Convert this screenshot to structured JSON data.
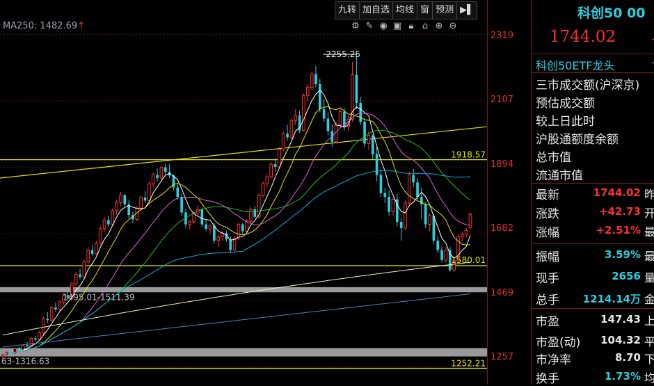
{
  "toolbar": [
    "九转",
    "加自选",
    "均线",
    "窗",
    "预测"
  ],
  "toolbar_pin": "▶▌",
  "ma_label": "MA250: 1482.69",
  "ma_arrow": "↑",
  "icons": [
    "gear-icon",
    "pen-icon",
    "eye-icon",
    "briefcase-icon",
    "lock-icon",
    "lock-open-icon",
    "zoom-in-icon",
    "zoom-out-icon"
  ],
  "y_ticks": [
    "2319",
    "2107",
    "1894",
    "1682",
    "1469",
    "1257"
  ],
  "annotations": {
    "high": "2255.25",
    "line1": "1918.57",
    "line2": "1580.01",
    "line3": "1252.21",
    "band1": "1495.01-1511.39",
    "band2": "63-1316.63"
  },
  "side": {
    "title": "科创50 00",
    "price": "1744.02",
    "price_tail": "+",
    "sector": "科创50ETF龙头",
    "sector_tail": "-",
    "info_labels": [
      "三市成交额(沪深京)",
      "预估成交额",
      "较上日此时",
      "沪股通额度余额",
      "总市值",
      "流通市值"
    ],
    "stats": [
      {
        "label": "最新",
        "value": "1744.02",
        "color": "#ff3030",
        "right": "昨"
      },
      {
        "label": "涨跌",
        "value": "+42.73",
        "color": "#ff3030",
        "right": "开"
      },
      {
        "label": "涨幅",
        "value": "+2.51%",
        "color": "#ff3030",
        "right": "最"
      },
      {
        "label": "振幅",
        "value": "3.59%",
        "color": "#2ad0e0",
        "right": "最"
      },
      {
        "label": "现手",
        "value": "2656",
        "color": "#2ad0e0",
        "right": "量"
      },
      {
        "label": "总手",
        "value": "1214.14万",
        "color": "#2ad0e0",
        "right": "金"
      },
      {
        "label": "市盈",
        "value": "147.43",
        "color": "#e8e8e8",
        "right": "上"
      },
      {
        "label": "市盈(动)",
        "value": "104.32",
        "color": "#e8e8e8",
        "right": "平"
      },
      {
        "label": "市净率",
        "value": "8.70",
        "color": "#e8e8e8",
        "right": "下"
      },
      {
        "label": "换手",
        "value": "1.73%",
        "color": "#2ad0e0",
        "right": "均"
      }
    ]
  },
  "colors": {
    "up": "#ff3030",
    "down": "#2ad0e0",
    "ma5": "#ffffff",
    "ma10": "#e6e600",
    "ma20": "#e060e0",
    "ma30": "#20c020",
    "ma60": "#00b0e0",
    "ma120": "#f0f0c0",
    "ma250": "#5080c0"
  },
  "chart_data": {
    "type": "candlestick",
    "ylim": [
      1200,
      2380
    ],
    "ohlc": [
      [
        1292,
        1300,
        1282,
        1296
      ],
      [
        1296,
        1310,
        1290,
        1304
      ],
      [
        1304,
        1312,
        1296,
        1300
      ],
      [
        1300,
        1318,
        1296,
        1314
      ],
      [
        1314,
        1320,
        1306,
        1310
      ],
      [
        1310,
        1330,
        1306,
        1326
      ],
      [
        1326,
        1336,
        1318,
        1322
      ],
      [
        1322,
        1352,
        1318,
        1348
      ],
      [
        1348,
        1356,
        1338,
        1344
      ],
      [
        1344,
        1372,
        1340,
        1366
      ],
      [
        1366,
        1418,
        1360,
        1410
      ],
      [
        1410,
        1432,
        1398,
        1406
      ],
      [
        1406,
        1450,
        1400,
        1446
      ],
      [
        1446,
        1462,
        1432,
        1440
      ],
      [
        1440,
        1470,
        1436,
        1464
      ],
      [
        1464,
        1492,
        1455,
        1486
      ],
      [
        1486,
        1500,
        1470,
        1478
      ],
      [
        1478,
        1530,
        1472,
        1522
      ],
      [
        1522,
        1560,
        1514,
        1552
      ],
      [
        1552,
        1570,
        1536,
        1544
      ],
      [
        1544,
        1600,
        1540,
        1592
      ],
      [
        1592,
        1640,
        1584,
        1630
      ],
      [
        1630,
        1646,
        1612,
        1618
      ],
      [
        1618,
        1660,
        1612,
        1652
      ],
      [
        1652,
        1706,
        1644,
        1698
      ],
      [
        1698,
        1736,
        1688,
        1726
      ],
      [
        1726,
        1740,
        1704,
        1712
      ],
      [
        1712,
        1764,
        1706,
        1756
      ],
      [
        1756,
        1790,
        1742,
        1782
      ],
      [
        1782,
        1816,
        1770,
        1806
      ],
      [
        1806,
        1808,
        1770,
        1776
      ],
      [
        1776,
        1790,
        1730,
        1742
      ],
      [
        1742,
        1752,
        1716,
        1728
      ],
      [
        1728,
        1770,
        1722,
        1764
      ],
      [
        1764,
        1804,
        1756,
        1798
      ],
      [
        1798,
        1818,
        1780,
        1788
      ],
      [
        1788,
        1850,
        1782,
        1842
      ],
      [
        1842,
        1878,
        1830,
        1870
      ],
      [
        1870,
        1890,
        1850,
        1860
      ],
      [
        1860,
        1900,
        1852,
        1894
      ],
      [
        1894,
        1906,
        1872,
        1880
      ],
      [
        1880,
        1904,
        1860,
        1868
      ],
      [
        1868,
        1872,
        1822,
        1830
      ],
      [
        1830,
        1840,
        1790,
        1800
      ],
      [
        1800,
        1812,
        1740,
        1750
      ],
      [
        1750,
        1762,
        1700,
        1712
      ],
      [
        1712,
        1726,
        1696,
        1720
      ],
      [
        1720,
        1756,
        1712,
        1748
      ],
      [
        1748,
        1774,
        1738,
        1760
      ],
      [
        1760,
        1764,
        1704,
        1712
      ],
      [
        1712,
        1726,
        1690,
        1698
      ],
      [
        1698,
        1712,
        1680,
        1708
      ],
      [
        1708,
        1716,
        1650,
        1660
      ],
      [
        1660,
        1678,
        1640,
        1672
      ],
      [
        1672,
        1690,
        1660,
        1684
      ],
      [
        1684,
        1692,
        1656,
        1664
      ],
      [
        1664,
        1674,
        1620,
        1630
      ],
      [
        1630,
        1674,
        1626,
        1668
      ],
      [
        1668,
        1720,
        1662,
        1712
      ],
      [
        1712,
        1716,
        1680,
        1690
      ],
      [
        1690,
        1728,
        1686,
        1722
      ],
      [
        1722,
        1768,
        1716,
        1760
      ],
      [
        1760,
        1770,
        1730,
        1736
      ],
      [
        1736,
        1812,
        1730,
        1804
      ],
      [
        1804,
        1850,
        1798,
        1842
      ],
      [
        1842,
        1872,
        1830,
        1864
      ],
      [
        1864,
        1912,
        1858,
        1904
      ],
      [
        1904,
        1924,
        1880,
        1896
      ],
      [
        1896,
        1960,
        1890,
        1952
      ],
      [
        1952,
        2010,
        1946,
        2002
      ],
      [
        2002,
        2030,
        1980,
        1990
      ],
      [
        1990,
        2050,
        1984,
        2044
      ],
      [
        2044,
        2080,
        2030,
        2060
      ],
      [
        2060,
        2074,
        2004,
        2012
      ],
      [
        2012,
        2130,
        2008,
        2124
      ],
      [
        2124,
        2160,
        2106,
        2150
      ],
      [
        2150,
        2200,
        2140,
        2192
      ],
      [
        2192,
        2218,
        2150,
        2160
      ],
      [
        2160,
        2176,
        2070,
        2080
      ],
      [
        2080,
        2112,
        2040,
        2050
      ],
      [
        2050,
        2070,
        1996,
        2010
      ],
      [
        2010,
        2032,
        1960,
        1976
      ],
      [
        1976,
        2040,
        1970,
        2030
      ],
      [
        2030,
        2080,
        2020,
        2072
      ],
      [
        2072,
        2084,
        2012,
        2024
      ],
      [
        2024,
        2060,
        2010,
        2048
      ],
      [
        2048,
        2232,
        2040,
        2190
      ],
      [
        2190,
        2255,
        2080,
        2100
      ],
      [
        2100,
        2120,
        2030,
        2040
      ],
      [
        2040,
        2052,
        1960,
        1970
      ],
      [
        1970,
        2010,
        1950,
        1996
      ],
      [
        1996,
        2000,
        1920,
        1936
      ],
      [
        1936,
        1960,
        1850,
        1870
      ],
      [
        1870,
        1886,
        1800,
        1812
      ],
      [
        1812,
        1830,
        1780,
        1800
      ],
      [
        1800,
        1820,
        1740,
        1752
      ],
      [
        1752,
        1800,
        1740,
        1792
      ],
      [
        1792,
        1810,
        1706,
        1720
      ],
      [
        1720,
        1732,
        1660,
        1700
      ],
      [
        1700,
        1790,
        1694,
        1780
      ],
      [
        1780,
        1880,
        1774,
        1870
      ],
      [
        1870,
        1890,
        1830,
        1846
      ],
      [
        1846,
        1860,
        1790,
        1800
      ],
      [
        1800,
        1830,
        1730,
        1776
      ],
      [
        1776,
        1784,
        1700,
        1712
      ],
      [
        1712,
        1748,
        1690,
        1740
      ],
      [
        1740,
        1746,
        1650,
        1660
      ],
      [
        1660,
        1674,
        1620,
        1630
      ],
      [
        1630,
        1640,
        1590,
        1598
      ],
      [
        1598,
        1640,
        1590,
        1630
      ],
      [
        1630,
        1640,
        1560,
        1566
      ],
      [
        1566,
        1600,
        1560,
        1596
      ],
      [
        1596,
        1680,
        1590,
        1672
      ],
      [
        1672,
        1690,
        1660,
        1680
      ],
      [
        1680,
        1700,
        1670,
        1692
      ],
      [
        1701,
        1750,
        1696,
        1744
      ]
    ],
    "levels": [
      1918.57,
      1580.01,
      1252.21
    ],
    "bands": [
      [
        1495.01,
        1511.39
      ],
      [
        1290,
        1316.63
      ]
    ],
    "high_label": 2255.25
  }
}
